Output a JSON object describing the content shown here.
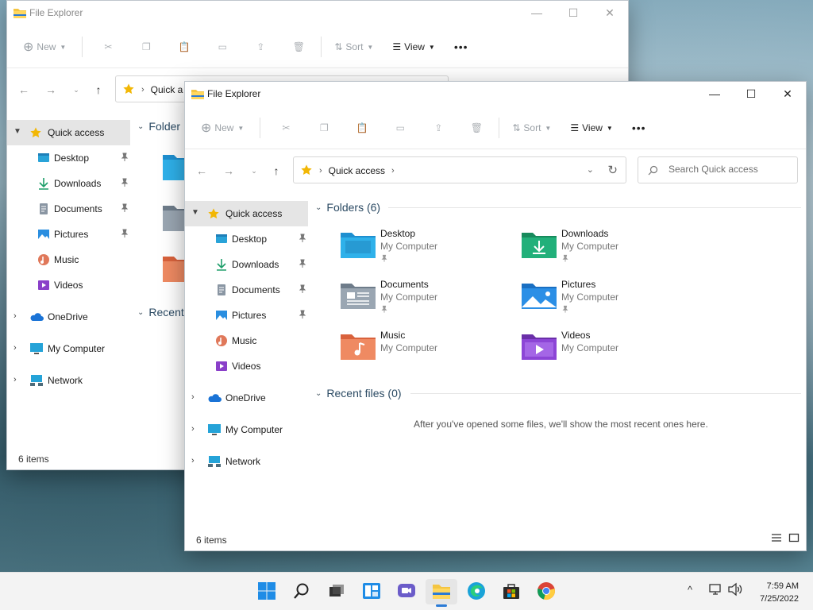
{
  "app": {
    "title": "File Explorer"
  },
  "toolbar": {
    "new_label": "New",
    "sort_label": "Sort",
    "view_label": "View",
    "more_label": "•••"
  },
  "address": {
    "location": "Quick access",
    "location_back_truncated": "Quick a"
  },
  "search": {
    "placeholder": "Search Quick access"
  },
  "sidebar": {
    "quick_access": "Quick access",
    "pinned": [
      {
        "label": "Desktop"
      },
      {
        "label": "Downloads"
      },
      {
        "label": "Documents"
      },
      {
        "label": "Pictures"
      },
      {
        "label": "Music"
      },
      {
        "label": "Videos"
      }
    ],
    "onedrive": "OneDrive",
    "my_computer": "My Computer",
    "network": "Network"
  },
  "content": {
    "folders_header": "Folders (6)",
    "folders_header_back": "Folder",
    "recent_header": "Recent files (0)",
    "recent_header_back": "Recent",
    "empty_message": "After you've opened some files, we'll show the most recent ones here.",
    "folders": [
      {
        "name": "Desktop",
        "location": "My Computer",
        "pinned": true
      },
      {
        "name": "Downloads",
        "location": "My Computer",
        "pinned": true
      },
      {
        "name": "Documents",
        "location": "My Computer",
        "pinned": true
      },
      {
        "name": "Pictures",
        "location": "My Computer",
        "pinned": true
      },
      {
        "name": "Music",
        "location": "My Computer",
        "pinned": false
      },
      {
        "name": "Videos",
        "location": "My Computer",
        "pinned": false
      }
    ]
  },
  "status": {
    "items": "6 items"
  },
  "taskbar": {
    "apps": [
      "start",
      "search",
      "task-view",
      "widgets",
      "chat",
      "file-explorer",
      "edge",
      "store",
      "chrome"
    ],
    "clock_time": "7:59 AM",
    "clock_date": "7/25/2022",
    "tray_overflow": "^"
  },
  "colors": {
    "accent": "#2b7bd6",
    "folder_yellow": "#f4c542",
    "star": "#f2b705"
  }
}
